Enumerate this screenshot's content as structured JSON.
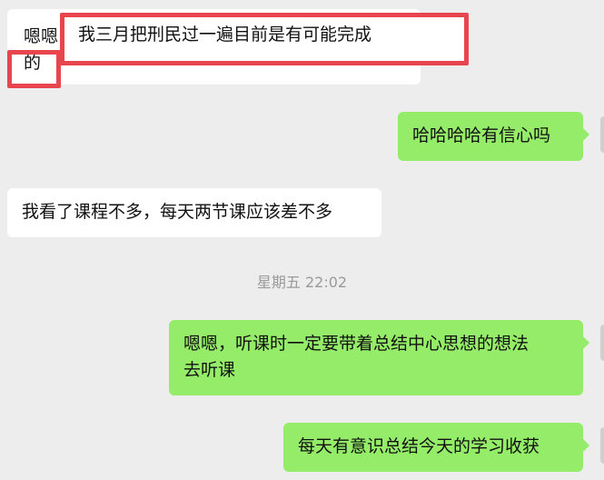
{
  "messages": [
    {
      "id": "m1",
      "side": "left",
      "lines": [
        "嗯嗯",
        "的"
      ],
      "overlay": "我三月把刑民过一遍目前是有可能完成"
    },
    {
      "id": "m2",
      "side": "right",
      "text": "哈哈哈哈有信心吗"
    },
    {
      "id": "m3",
      "side": "left",
      "text": "我看了课程不多，每天两节课应该差不多"
    },
    {
      "id": "m4",
      "side": "right",
      "lines": [
        "嗯嗯，听课时一定要带着总结中心思想的想法",
        "去听课"
      ]
    },
    {
      "id": "m5",
      "side": "right",
      "text": "每天有意识总结今天的学习收获"
    }
  ],
  "timestamp": "星期五 22:02",
  "colors": {
    "background": "#ededed",
    "incoming_bubble": "#ffffff",
    "outgoing_bubble": "#95ec69",
    "annotation": "#e9454f",
    "timestamp_text": "#9a9a9a"
  }
}
